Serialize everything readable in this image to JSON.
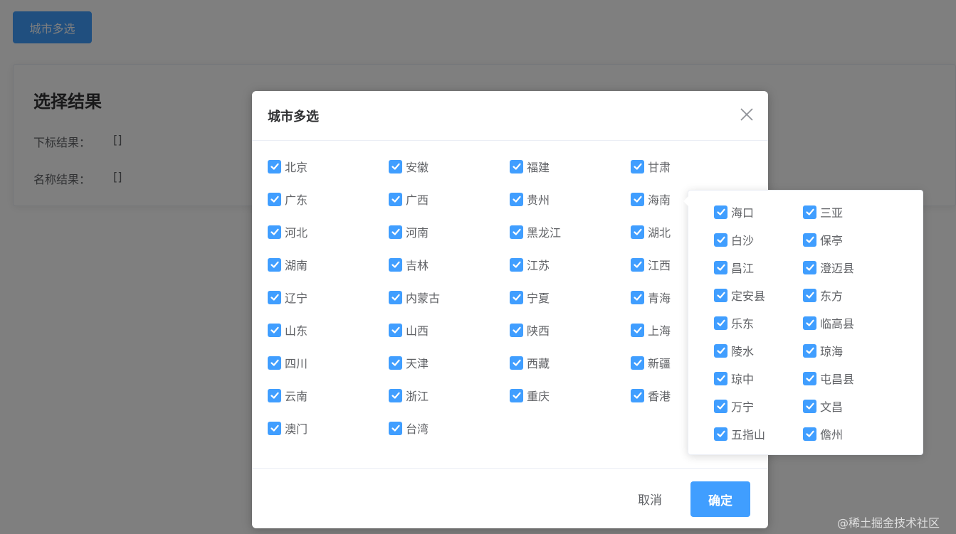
{
  "page": {
    "open_button_label": "城市多选",
    "result_title": "选择结果",
    "index_label": "下标结果：",
    "index_value": "[]",
    "name_label": "名称结果：",
    "name_value": "[]"
  },
  "dialog": {
    "title": "城市多选",
    "cancel_label": "取消",
    "confirm_label": "确定",
    "provinces": [
      "北京",
      "安徽",
      "福建",
      "甘肃",
      "广东",
      "广西",
      "贵州",
      "海南",
      "河北",
      "河南",
      "黑龙江",
      "湖北",
      "湖南",
      "吉林",
      "江苏",
      "江西",
      "辽宁",
      "内蒙古",
      "宁夏",
      "青海",
      "山东",
      "山西",
      "陕西",
      "上海",
      "四川",
      "天津",
      "西藏",
      "新疆",
      "云南",
      "浙江",
      "重庆",
      "香港",
      "澳门",
      "台湾"
    ]
  },
  "popover": {
    "cities": [
      "海口",
      "三亚",
      "白沙",
      "保亭",
      "昌江",
      "澄迈县",
      "定安县",
      "东方",
      "乐东",
      "临高县",
      "陵水",
      "琼海",
      "琼中",
      "屯昌县",
      "万宁",
      "文昌",
      "五指山",
      "儋州"
    ]
  },
  "watermark": "@稀土掘金技术社区",
  "colors": {
    "primary": "#409eff",
    "mask": "rgba(0,0,0,0.5)"
  }
}
